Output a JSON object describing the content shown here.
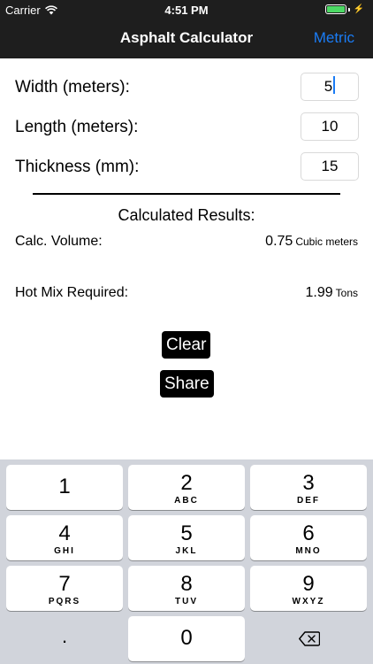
{
  "status": {
    "carrier": "Carrier",
    "time": "4:51 PM",
    "charging_glyph": "⚡"
  },
  "nav": {
    "title": "Asphalt Calculator",
    "right_label": "Metric"
  },
  "form": {
    "width": {
      "label": "Width (meters):",
      "value": "5"
    },
    "length": {
      "label": "Length (meters):",
      "value": "10"
    },
    "thickness": {
      "label": "Thickness (mm):",
      "value": "15"
    }
  },
  "results": {
    "title": "Calculated Results:",
    "volume": {
      "label": "Calc. Volume:",
      "value": "0.75",
      "unit": "Cubic meters"
    },
    "hotmix": {
      "label": "Hot Mix Required:",
      "value": "1.99",
      "unit": "Tons"
    }
  },
  "actions": {
    "clear": "Clear",
    "share": "Share"
  },
  "keyboard": {
    "keys": [
      {
        "digit": "1",
        "letters": ""
      },
      {
        "digit": "2",
        "letters": "ABC"
      },
      {
        "digit": "3",
        "letters": "DEF"
      },
      {
        "digit": "4",
        "letters": "GHI"
      },
      {
        "digit": "5",
        "letters": "JKL"
      },
      {
        "digit": "6",
        "letters": "MNO"
      },
      {
        "digit": "7",
        "letters": "PQRS"
      },
      {
        "digit": "8",
        "letters": "TUV"
      },
      {
        "digit": "9",
        "letters": "WXYZ"
      },
      {
        "digit": "0",
        "letters": ""
      }
    ],
    "decimal": "."
  },
  "icons": {
    "wifi": "wifi-icon",
    "battery": "battery-icon",
    "backspace": "backspace-icon"
  },
  "colors": {
    "nav_bg": "#1e1e1e",
    "accent": "#1a7cf5",
    "battery": "#4cd964",
    "keyboard_bg": "#d1d4db"
  }
}
